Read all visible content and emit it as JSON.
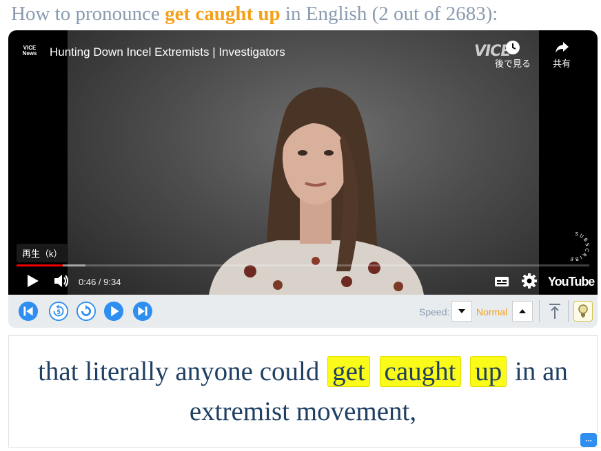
{
  "heading": {
    "prefix": "How to pronounce ",
    "keyword": "get caught up",
    "suffix": " in English (2 out of 2683):"
  },
  "video": {
    "channel_logo": "VICE News",
    "title": "Hunting Down Incel Extremists | Investigators",
    "brand_watermark": "VICE",
    "watch_later_label": "後で見る",
    "share_label": "共有",
    "subscribe_label": "SUBSCRIBE",
    "tooltip": "再生（k）",
    "current_time": "0:46",
    "time_separator": " / ",
    "duration": "9:34",
    "progress_played": 0.081,
    "progress_loaded": 0.12,
    "youtube_label": "YouTube"
  },
  "toolbar": {
    "speed_label": "Speed:",
    "speed_value": "Normal",
    "icons": [
      "previous-icon",
      "replay-5-icon",
      "repeat-icon",
      "play-icon",
      "next-icon",
      "scroll-top-icon",
      "lightbulb-icon"
    ]
  },
  "caption": {
    "text_before": "that literally anyone could ",
    "word1": "get",
    "word2": "caught",
    "word3": "up",
    "text_after": " in an extremist movement,",
    "chat_icon_label": "..."
  },
  "colors": {
    "heading": "#8a9bb0",
    "keyword": "#f5a01a",
    "caption_text": "#1f3f63",
    "highlight": "#fbfb19",
    "accent_blue": "#2f8ff0",
    "progress_red": "#ee0000"
  }
}
